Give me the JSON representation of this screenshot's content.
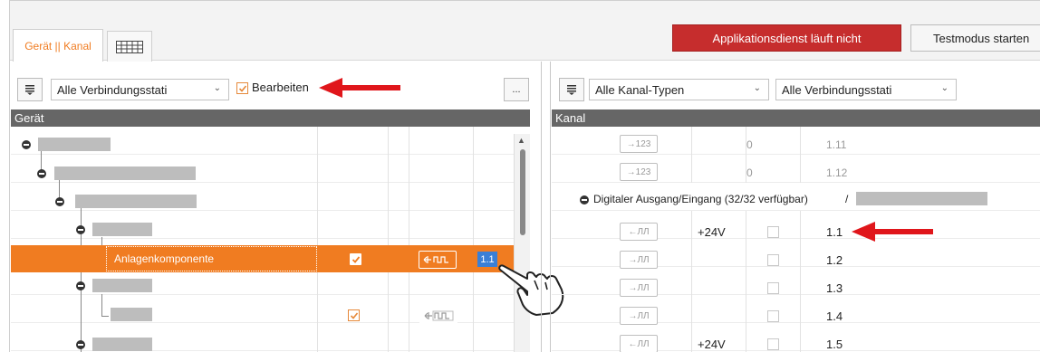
{
  "tabs": {
    "active_label": "Gerät || Kanal",
    "grid_tab_icon": "grid-icon"
  },
  "header_buttons": {
    "app_service_label": "Applikationsdienst läuft nicht",
    "test_mode_label": "Testmodus starten"
  },
  "left_panel": {
    "filter_select": "Alle Verbindungsstati",
    "edit_checkbox_label": "Bearbeiten",
    "edit_checked": true,
    "more_button": "...",
    "column_header": "Gerät",
    "selected_row": {
      "label": "Anlagenkomponente",
      "channel": "1.1"
    }
  },
  "right_panel": {
    "type_select": "Alle Kanal-Typen",
    "status_select": "Alle Verbindungsstati",
    "column_header": "Kanal",
    "group_label": "Digitaler Ausgang/Eingang (32/32 verfügbar)",
    "group_separator": "/",
    "rows_top": [
      {
        "icon": "→123",
        "count": "0",
        "id": "1.11"
      },
      {
        "icon": "→123",
        "count": "0",
        "id": "1.12"
      }
    ],
    "rows_digital": [
      {
        "icon": "←ЛЛ",
        "voltage": "+24V",
        "id": "1.1"
      },
      {
        "icon": "→ЛЛ",
        "voltage": "",
        "id": "1.2"
      },
      {
        "icon": "→ЛЛ",
        "voltage": "",
        "id": "1.3"
      },
      {
        "icon": "→ЛЛ",
        "voltage": "",
        "id": "1.4"
      },
      {
        "icon": "←ЛЛ",
        "voltage": "+24V",
        "id": "1.5"
      }
    ]
  },
  "colors": {
    "accent_orange": "#f07c21",
    "red_button": "#c62d2d",
    "arrow_red": "#e0161b",
    "header_gray": "#666666",
    "placeholder_gray": "#bdbdbd"
  }
}
